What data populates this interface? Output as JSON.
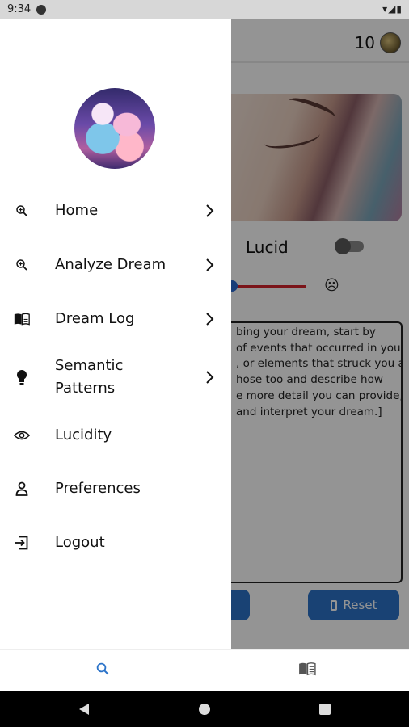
{
  "status_bar": {
    "time": "9:34",
    "right_icons": "▾◢▮"
  },
  "background_screen": {
    "credits": "10",
    "lucid_label": "Lucid",
    "dream_prompt_lines": [
      "bing your dream, start by",
      "of events that occurred in your",
      ", or elements that struck you as",
      "hose too and describe how",
      "e more detail you can provide,",
      "and interpret your dream.]"
    ],
    "reset_label": "Reset"
  },
  "drawer": {
    "items": [
      {
        "label": "Home",
        "icon": "zoom-in-icon",
        "has_chevron": true
      },
      {
        "label": "Analyze Dream",
        "icon": "zoom-in-icon",
        "has_chevron": true
      },
      {
        "label": "Dream Log",
        "icon": "book-icon",
        "has_chevron": true
      },
      {
        "label": "Semantic\nPatterns",
        "icon": "lightbulb-icon",
        "has_chevron": true
      },
      {
        "label": "Lucidity",
        "icon": "eye-icon",
        "has_chevron": false
      },
      {
        "label": "Preferences",
        "icon": "person-icon",
        "has_chevron": false
      },
      {
        "label": "Logout",
        "icon": "logout-icon",
        "has_chevron": false
      }
    ]
  },
  "bottom_nav": {
    "tabs": [
      {
        "icon": "search-icon",
        "active": true
      },
      {
        "icon": "book-icon",
        "active": false
      }
    ]
  },
  "colors": {
    "accent": "#2b73c9",
    "slider": "#d4242c"
  }
}
